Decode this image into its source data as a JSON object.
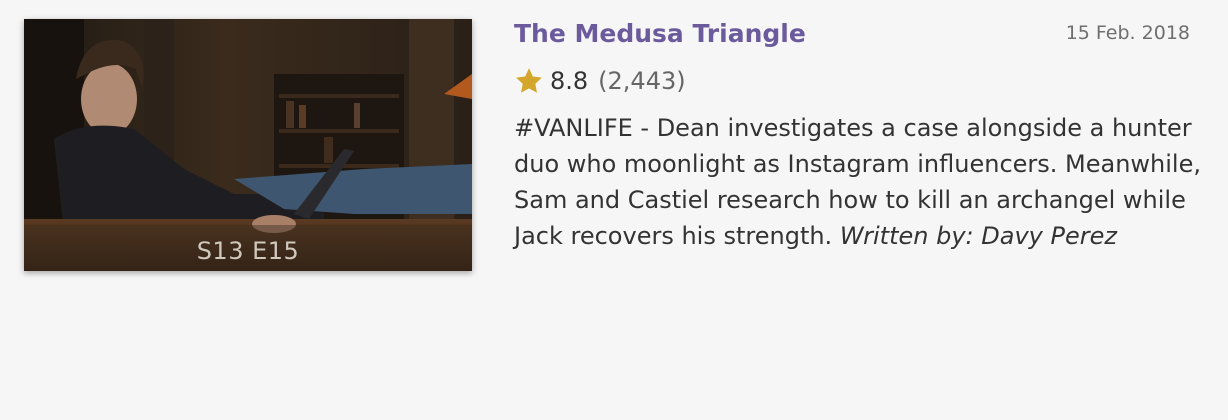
{
  "episode": {
    "title": "The Medusa Triangle",
    "airdate": "15 Feb. 2018",
    "episode_code": "S13 E15",
    "rating": {
      "value": "8.8",
      "count": "(2,443)",
      "star_icon": "star-icon",
      "star_color": "#d4a72c"
    },
    "description": "#VANLIFE - Dean investigates a case alongside a hunter duo who moonlight as Instagram influencers. Meanwhile, Sam and Castiel research how to kill an archangel while Jack recovers his strength.",
    "writer_label": "Written by:",
    "writer_name": "Davy Perez"
  },
  "colors": {
    "title": "#6b5a9c",
    "background": "#f6f6f6",
    "text": "#333333"
  }
}
